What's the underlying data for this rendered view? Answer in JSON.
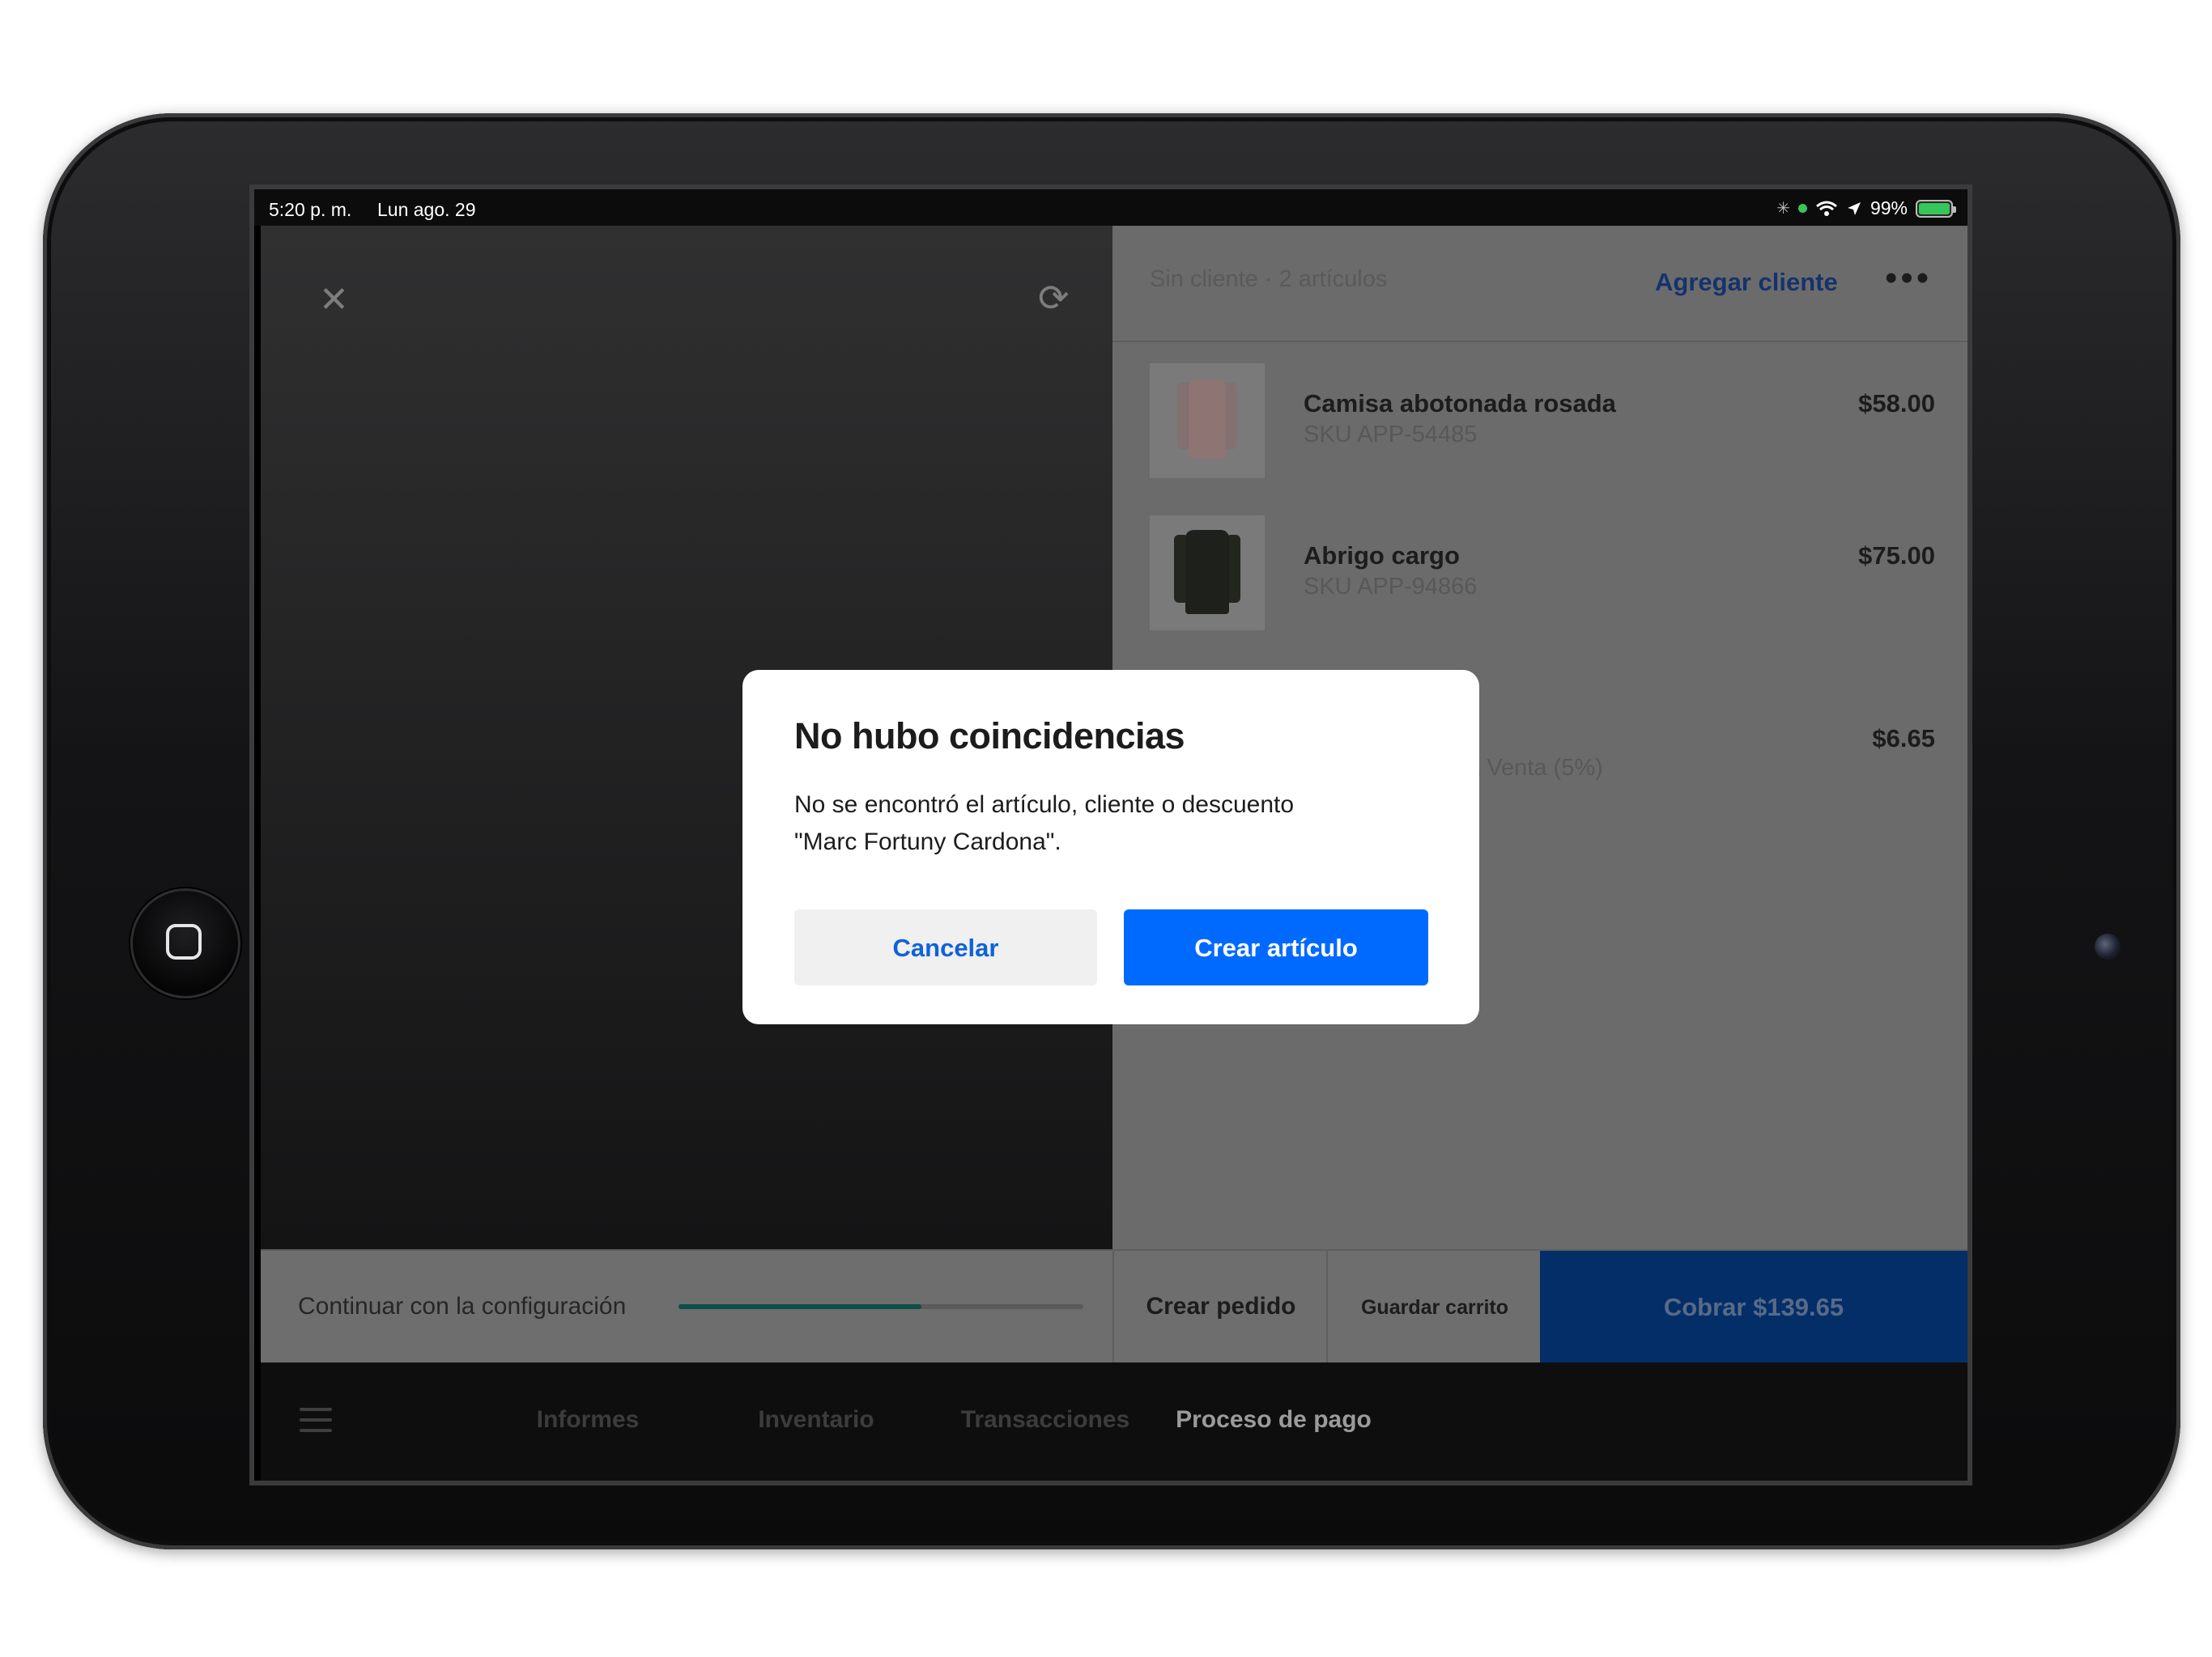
{
  "status_bar": {
    "time": "5:20 p. m.",
    "date": "Lun ago. 29",
    "battery": "99%",
    "battery_level": 0.99
  },
  "cart": {
    "summary": "Sin cliente · 2 artículos",
    "add_customer": "Agregar cliente",
    "more": "•••",
    "items": [
      {
        "name": "Camisa abotonada rosada",
        "sku": "SKU APP-54485",
        "price": "$58.00"
      },
      {
        "name": "Abrigo cargo",
        "sku": "SKU APP-94866",
        "price": "$75.00"
      }
    ],
    "tax": {
      "label": "La Venta (5%)",
      "price": "$6.65"
    }
  },
  "action_bar": {
    "setup_label": "Continuar con la configuración",
    "setup_progress": 0.6,
    "create_order": "Crear pedido",
    "save_cart": "Guardar carrito",
    "charge": "Cobrar $139.65"
  },
  "tabs": [
    "Informes",
    "Inventario",
    "Transacciones",
    "Proceso de pago"
  ],
  "active_tab": "Proceso de pago",
  "dialog": {
    "title": "No hubo coincidencias",
    "message_line1": "No se encontró el artículo, cliente o descuento",
    "message_line2": "\"Marc Fortuny Cardona\".",
    "cancel": "Cancelar",
    "create": "Crear artículo"
  },
  "colors": {
    "primary_blue": "#006aff",
    "link_blue": "#0f63d8",
    "setup_progress": "#0b4f45"
  }
}
